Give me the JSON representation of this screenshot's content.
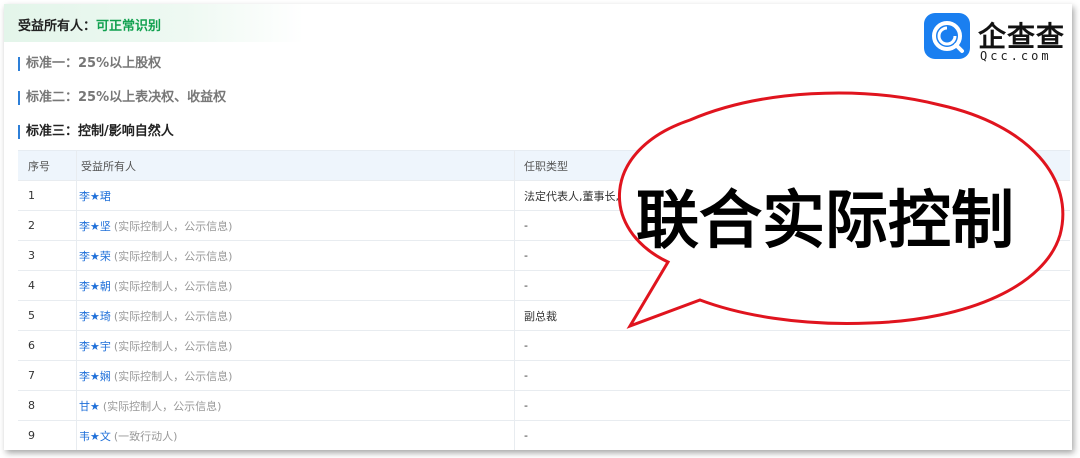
{
  "header": {
    "title": "受益所有人：",
    "status": "可正常识别"
  },
  "sections": [
    {
      "label": "标准一：25%以上股权"
    },
    {
      "label": "标准二：25%以上表决权、收益权"
    },
    {
      "label": "标准三：控制/影响自然人"
    }
  ],
  "table": {
    "columns": [
      "序号",
      "受益所有人",
      "任职类型"
    ],
    "rows": [
      {
        "no": "1",
        "name": "李★珺",
        "note": "",
        "role": "法定代表人,董事长,董事"
      },
      {
        "no": "2",
        "name": "李★坚",
        "note": "(实际控制人，公示信息)",
        "role": "-"
      },
      {
        "no": "3",
        "name": "李★荣",
        "note": "(实际控制人，公示信息)",
        "role": "-"
      },
      {
        "no": "4",
        "name": "李★朝",
        "note": "(实际控制人，公示信息)",
        "role": "-"
      },
      {
        "no": "5",
        "name": "李★琦",
        "note": "(实际控制人，公示信息)",
        "role": "副总裁"
      },
      {
        "no": "6",
        "name": "李★宇",
        "note": "(实际控制人，公示信息)",
        "role": "-"
      },
      {
        "no": "7",
        "name": "李★娴",
        "note": "(实际控制人，公示信息)",
        "role": "-"
      },
      {
        "no": "8",
        "name": "甘★",
        "note": "(实际控制人，公示信息)",
        "role": "-"
      },
      {
        "no": "9",
        "name": "韦★文",
        "note": "(一致行动人)",
        "role": "-"
      }
    ]
  },
  "logo": {
    "name": "企查查",
    "sub": "Qcc.com",
    "color": "#1a7ff0"
  },
  "callout": {
    "text": "联合实际控制",
    "border_color": "#e0141e"
  }
}
